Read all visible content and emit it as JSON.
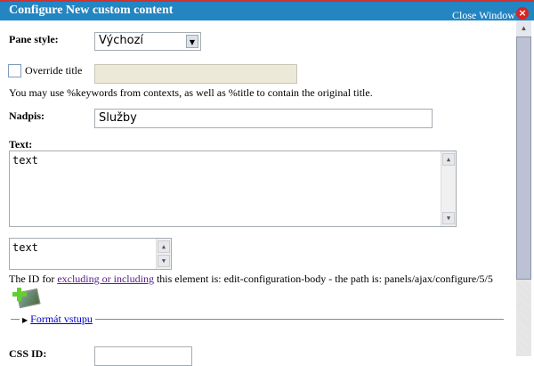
{
  "window": {
    "title": "Configure New custom content",
    "close_label": "Close Window"
  },
  "pane_style": {
    "label": "Pane style:",
    "value": "Výchozí"
  },
  "override": {
    "label": "Override title",
    "value": "",
    "help": "You may use %keywords from contexts, as well as %title to contain the original title."
  },
  "nadpis": {
    "label": "Nadpis:",
    "value": "Služby"
  },
  "text": {
    "label": "Text:",
    "value": "text",
    "summary_value": "text"
  },
  "id_note": {
    "prefix": "The ID for ",
    "link": "excluding or including",
    "suffix": " this element is: edit-configuration-body - the path is: panels/ajax/configure/5/5"
  },
  "format": {
    "label": "Formát vstupu"
  },
  "css_id": {
    "label": "CSS ID:",
    "value": ""
  }
}
